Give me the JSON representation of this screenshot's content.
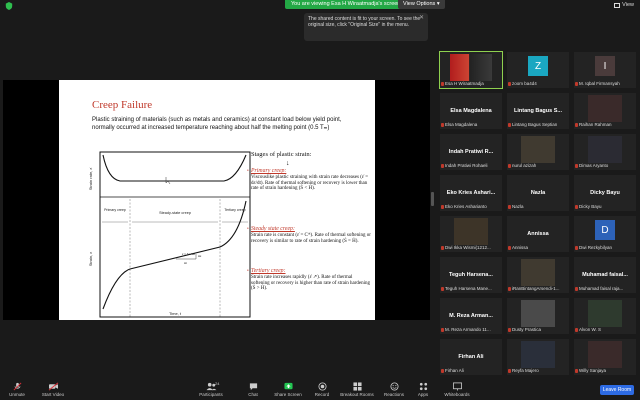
{
  "top": {
    "viewing_banner": "You are viewing Esa H Wiraatmadja's screen",
    "view_options": "View Options ▾",
    "view": "View"
  },
  "tooltip": {
    "text": "The shared content is fit to your screen. To see the original size, click \"Original Size\" in the menu."
  },
  "slide": {
    "title": "Creep Failure",
    "paragraph": "Plastic straining of materials (such as metals and ceramics) at constant load below yield point, normally occurred at increased temperature reaching about half the melting point (0.5 Tₘ)",
    "chart": {
      "top_ylabel": "Strain rate, ε̇",
      "bottom_ylabel": "Strain, ε",
      "xlabel": "Time, t",
      "region_primary": "Primary creep",
      "region_steady": "Steady-state creep",
      "region_tertiary": "Tertiary creep",
      "delta_eps": "Δε",
      "delta_t": "Δt",
      "rate_eq": "ε̇ = Δε / Δt"
    },
    "stages": {
      "heading": "Stages of plastic strain:",
      "arrow": "↓",
      "primary_title": "Primary creep:",
      "primary_text": "Viscouslike plastic straining with strain rate decreases (ε̇ = dε/dt). Rate of thermal softening or recovery is lower than rate of strain hardening (Ṡ < Ḣ).",
      "steady_title": "Steady state creep:",
      "steady_text": "Strain rate is constant (ε̇ = Cᵗʰ). Rate of thermal softening or recovery is similar to rate of strain hardening (Ṡ = Ḣ).",
      "tertiary_title": "Tertiary creep:",
      "tertiary_text": "Strain rate increases rapidly (ε̇ ↗). Rate of thermal softening or recovery is higher than rate of strain hardening (Ṡ > Ḣ)."
    }
  },
  "participants": [
    {
      "name": "",
      "caption": "Esa H Wiraatmadja",
      "type": "photo",
      "active": true
    },
    {
      "name": "",
      "caption": "zoom ba4d4",
      "type": "avatar",
      "letter": "Z",
      "color": "#1aa7c1"
    },
    {
      "name": "",
      "caption": "M. Iqbal Firmansyah",
      "type": "avatar",
      "letter": "I",
      "color": "#4a3b3b"
    },
    {
      "name": "Elsa Magdalena",
      "caption": "Elsa Magdalena",
      "type": "name"
    },
    {
      "name": "Lintang Bagus S...",
      "caption": "Lintang Bagus Septian",
      "type": "name"
    },
    {
      "name": "",
      "caption": "Raihan Rahman",
      "type": "photo"
    },
    {
      "name": "Indah Pratiwi R...",
      "caption": "Indah Pratiwi Rohaeli",
      "type": "name"
    },
    {
      "name": "",
      "caption": "nurul azizah",
      "type": "photo"
    },
    {
      "name": "",
      "caption": "Dimas Aryanto",
      "type": "photo"
    },
    {
      "name": "Eko Kries Ashari...",
      "caption": "Eko Kries Asharianto",
      "type": "name"
    },
    {
      "name": "Nazla",
      "caption": "Nazla",
      "type": "name"
    },
    {
      "name": "Dicky Bayu",
      "caption": "Dicky Bayu",
      "type": "name"
    },
    {
      "name": "",
      "caption": "Dwi Ikka Wismi(1212...",
      "type": "photo"
    },
    {
      "name": "Annissa",
      "caption": "Annissa",
      "type": "name"
    },
    {
      "name": "",
      "caption": "Dwi Rezkybilyan",
      "type": "avatar",
      "letter": "D",
      "color": "#2d62b8"
    },
    {
      "name": "Teguh Harsena...",
      "caption": "Teguh Harsena Mane...",
      "type": "name"
    },
    {
      "name": "",
      "caption": "iRanBintangArsendi-1...",
      "type": "photo"
    },
    {
      "name": "Muhamad faisal...",
      "caption": "Muhamad faisal raja...",
      "type": "name"
    },
    {
      "name": "M. Reza Arman...",
      "caption": "M. Reza Armando 11...",
      "type": "name"
    },
    {
      "name": "",
      "caption": "Dusty Prastica",
      "type": "photo"
    },
    {
      "name": "",
      "caption": "Alvon W. S",
      "type": "photo"
    },
    {
      "name": "Firhan Ali",
      "caption": "Firhan Ali",
      "type": "name"
    },
    {
      "name": "",
      "caption": "Reyfa Majero",
      "type": "photo"
    },
    {
      "name": "",
      "caption": "Willy Sanjaya",
      "type": "photo"
    }
  ],
  "toolbar": {
    "unmute": "Unmute",
    "start_video": "Start Video",
    "participants": "Participants",
    "participants_count": "24",
    "chat": "Chat",
    "share_screen": "Share Screen",
    "record": "Record",
    "breakout": "Breakout Rooms",
    "reactions": "Reactions",
    "apps": "Apps",
    "whiteboards": "Whiteboards",
    "leave": "Leave Room"
  }
}
